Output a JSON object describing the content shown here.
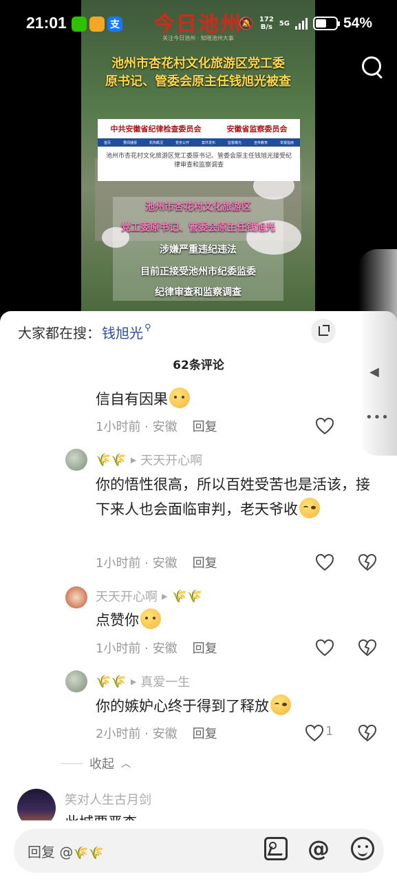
{
  "status_bar": {
    "time": "21:01",
    "app_icons": [
      {
        "name": "wechat-icon",
        "color": "#2dc100"
      },
      {
        "name": "weather-icon",
        "color": "#f5a623"
      },
      {
        "name": "alipay-icon",
        "color": "#1677ff",
        "glyph": "支"
      }
    ],
    "net_speed_value": "172",
    "net_speed_unit": "B/s",
    "signal_label": "5G",
    "battery_level": 0.54,
    "battery_pct": "54%"
  },
  "video": {
    "brand": "今日池州",
    "brand_sub": "关注今日池州 · 知晓池州大事",
    "headline_line1": "池州市杏花村文化旅游区党工委",
    "headline_line2": "原书记、管委会原主任钱旭光被查",
    "web_header_left": "中共安徽省纪律检查委员会",
    "web_header_right": "安徽省监察委员会",
    "web_nav": [
      "首页",
      "要闻播报",
      "机构概况",
      "党务公开",
      "案件发布",
      "监督曝光",
      "宣传教育",
      "举报指南"
    ],
    "web_text": "池州市杏花村文化旅游区党工委原书记、管委会原主任钱旭光接受纪律审查和监察调查",
    "overlay_lines": [
      "池州市杏花村文化旅游区",
      "党工委原书记、管委会原主任钱旭光",
      "涉嫌严重违纪违法",
      "目前正接受池州市纪委监委",
      "纪律审查和监察调查"
    ]
  },
  "search": {
    "label": "大家都在搜：",
    "term": "钱旭光"
  },
  "comments_count": "62条评论",
  "comments": [
    {
      "text": "信自有因果",
      "emoji": "think",
      "time": "1小时前",
      "location": "安徽",
      "reply": "回复"
    },
    {
      "from": "",
      "to": "天天开心啊",
      "text": "你的悟性很高，所以百姓受苦也是活该，接下来人也会面临审判，老天爷收",
      "emoji": "smug",
      "time": "1小时前",
      "location": "安徽",
      "reply": "回复"
    },
    {
      "from": "天天开心啊",
      "to": "",
      "text": "点赞你",
      "emoji": "think",
      "time": "1小时前",
      "location": "安徽",
      "reply": "回复"
    },
    {
      "from": "",
      "to": "真爱一生",
      "text": "你的嫉妒心终于得到了释放",
      "emoji": "smug",
      "time": "2小时前",
      "location": "安徽",
      "reply": "回复",
      "likes": "1"
    }
  ],
  "collapse_label": "收起",
  "next_comment": {
    "user": "笑对人生古月剑",
    "text": "此城要严查"
  },
  "reply_bar": {
    "placeholder": "回复 @"
  },
  "wheat_emoji": "🌾🌾"
}
